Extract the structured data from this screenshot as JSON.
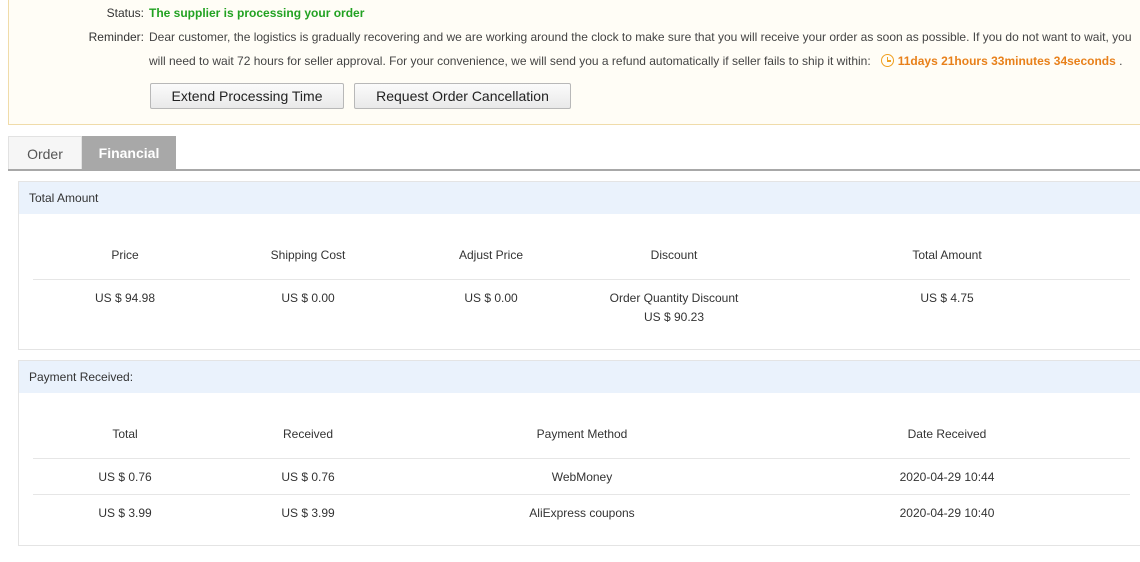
{
  "status": {
    "status_label": "Status:",
    "status_value": "The supplier is processing your order",
    "reminder_label": "Reminder:",
    "reminder_line1": "Dear customer, the logistics is gradually recovering and we are working around the clock to make sure that you will receive your order as soon as possible. If you do not want to wait, you",
    "reminder_line2": "will need to wait 72 hours for seller approval. For your convenience, we will send you a refund automatically if seller fails to ship it within:",
    "countdown": "11days 21hours 33minutes 34seconds",
    "countdown_suffix": ".",
    "extend_button": "Extend Processing Time",
    "cancel_button": "Request Order Cancellation"
  },
  "tabs": [
    {
      "label": "Order",
      "active": false
    },
    {
      "label": "Financial",
      "active": true
    }
  ],
  "total_amount": {
    "title": "Total Amount",
    "headers": [
      "Price",
      "Shipping Cost",
      "Adjust Price",
      "Discount",
      "Total Amount"
    ],
    "price": "US $ 94.98",
    "shipping": "US $ 0.00",
    "adjust": "US $ 0.00",
    "discount_name": "Order Quantity Discount",
    "discount_value": "US $ 90.23",
    "total": "US $ 4.75"
  },
  "payment": {
    "title": "Payment Received:",
    "headers": [
      "Total",
      "Received",
      "Payment Method",
      "Date Received"
    ],
    "rows": [
      {
        "total": "US $ 0.76",
        "received": "US $ 0.76",
        "method": "WebMoney",
        "date": "2020-04-29 10:44"
      },
      {
        "total": "US $ 3.99",
        "received": "US $ 3.99",
        "method": "AliExpress coupons",
        "date": "2020-04-29 10:40"
      }
    ]
  },
  "colors": {
    "status_green": "#22a222",
    "countdown_orange": "#e8801a",
    "panel_header_bg": "#eaf2fc",
    "tab_active_bg": "#a8a8a8"
  }
}
